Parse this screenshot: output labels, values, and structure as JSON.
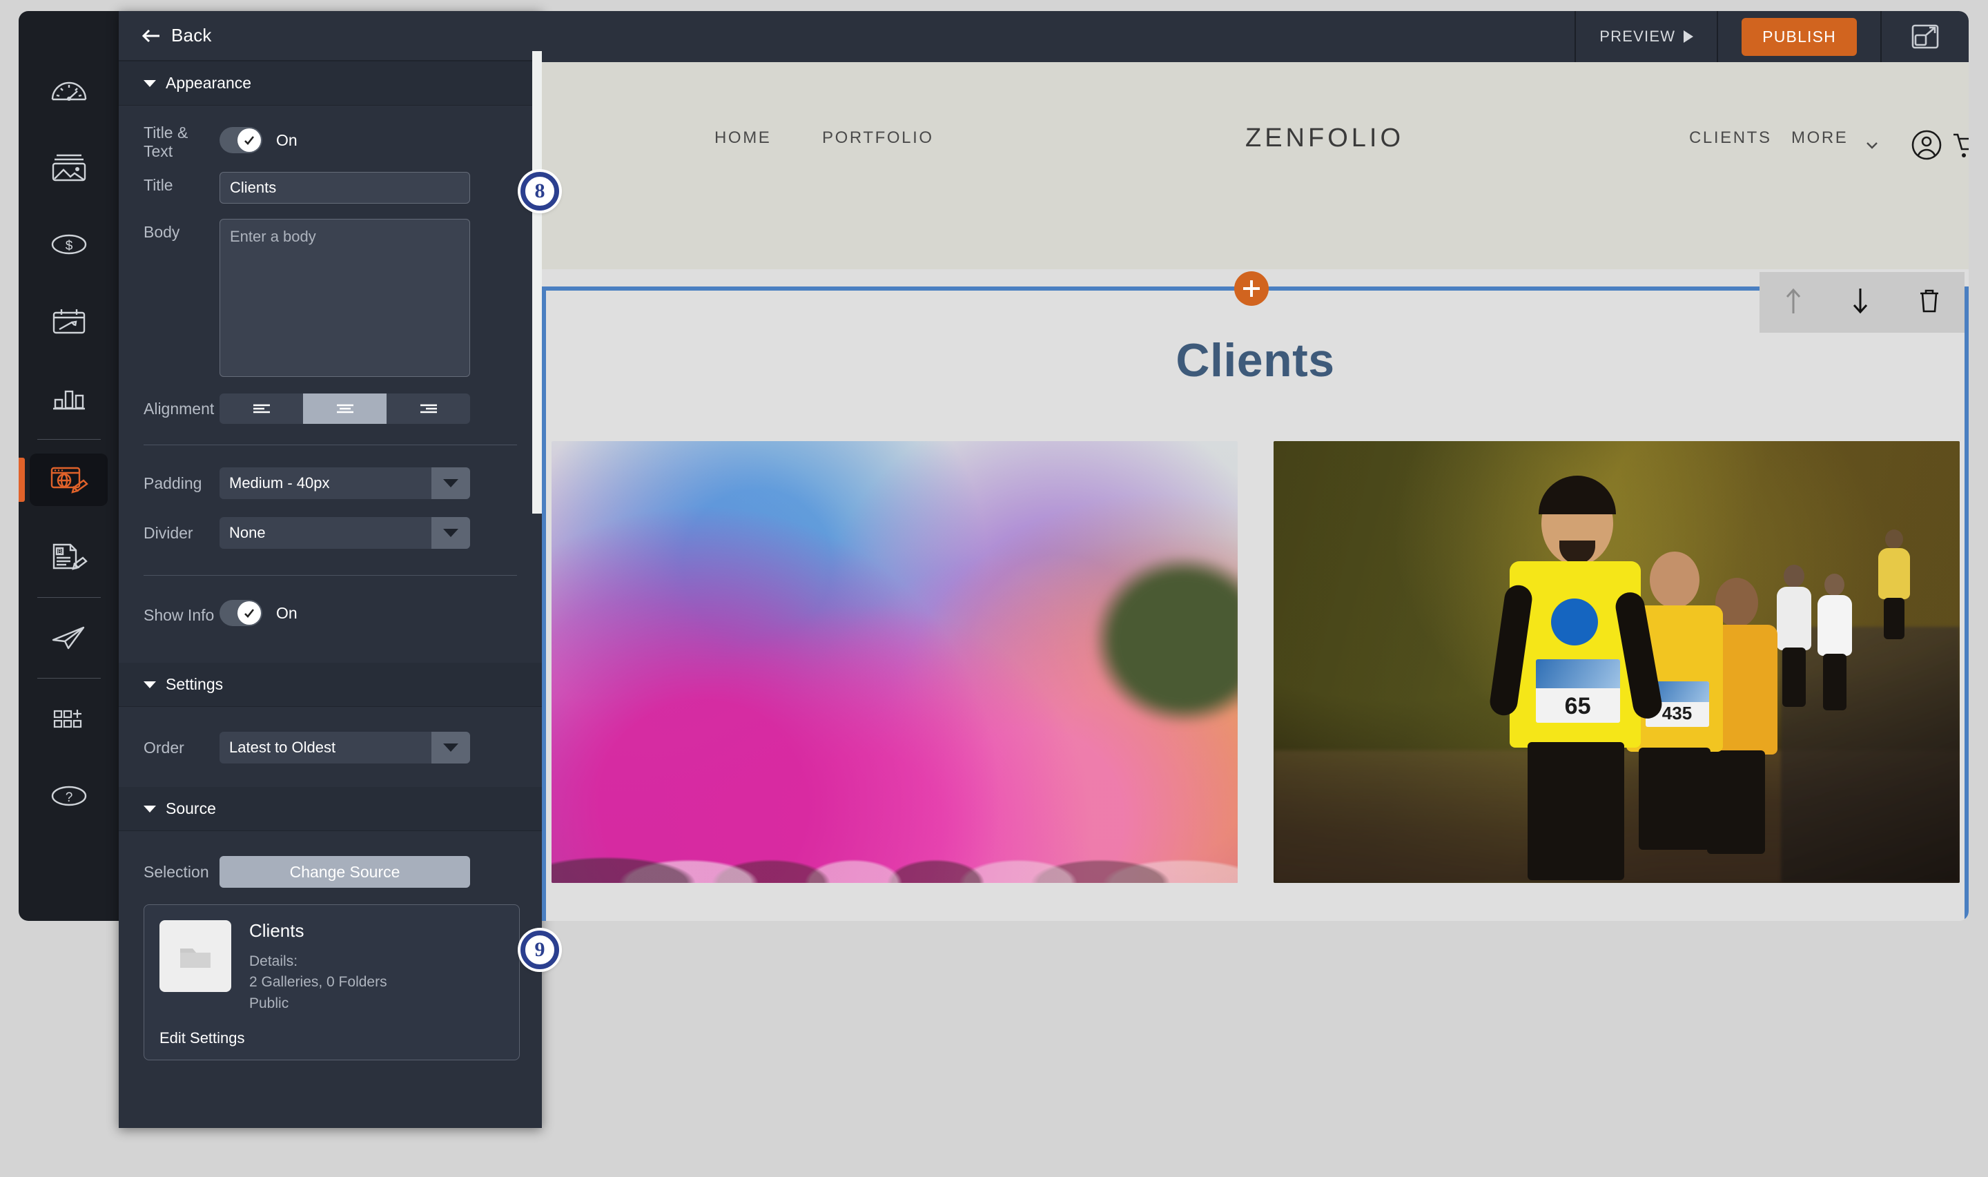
{
  "rail": {
    "items": [
      {
        "name": "dashboard-icon",
        "icon": "gauge"
      },
      {
        "name": "photos-icon",
        "icon": "image"
      },
      {
        "name": "sales-icon",
        "icon": "dollar"
      },
      {
        "name": "bookings-icon",
        "icon": "calendar"
      },
      {
        "name": "stats-icon",
        "icon": "bar-chart"
      },
      {
        "name": "website-editor-icon",
        "icon": "website-pencil"
      },
      {
        "name": "blog-editor-icon",
        "icon": "document-pencil"
      },
      {
        "name": "marketing-icon",
        "icon": "paper-plane"
      },
      {
        "name": "apps-icon",
        "icon": "grid-plus"
      },
      {
        "name": "help-icon",
        "icon": "question"
      }
    ]
  },
  "panel": {
    "back_label": "Back",
    "sections": {
      "appearance": "Appearance",
      "settings": "Settings",
      "source": "Source"
    },
    "title_text_label": "Title & Text",
    "title_text_state": "On",
    "title_label": "Title",
    "title_value": "Clients",
    "body_label": "Body",
    "body_value": "",
    "body_placeholder": "Enter a body",
    "alignment_label": "Alignment",
    "alignment_selected": "center",
    "padding_label": "Padding",
    "padding_value": "Medium - 40px",
    "divider_label": "Divider",
    "divider_value": "None",
    "show_info_label": "Show Info",
    "show_info_state": "On",
    "order_label": "Order",
    "order_value": "Latest to Oldest",
    "selection_label": "Selection",
    "change_source_label": "Change Source",
    "source_card": {
      "title": "Clients",
      "details_label": "Details:",
      "details_counts": "2 Galleries, 0 Folders",
      "visibility": "Public",
      "edit_label": "Edit Settings"
    }
  },
  "topbar": {
    "preview_label": "PREVIEW",
    "publish_label": "PUBLISH",
    "expand_icon": "expand-icon"
  },
  "site": {
    "brand": "ZENFOLIO",
    "nav_left": [
      "HOME",
      "PORTFOLIO"
    ],
    "nav_right": [
      "CLIENTS",
      "MORE"
    ],
    "account_icon": "account-circle-icon",
    "cart_icon": "shopping-cart-icon",
    "page_title": "Clients",
    "block_toolbar": [
      "move-up-icon",
      "move-down-icon",
      "delete-icon"
    ],
    "add_block_icon": "plus-icon",
    "gallery_images": [
      {
        "alt": "color-festival-crowd"
      },
      {
        "alt": "marathon-runners",
        "bibs": [
          "65",
          "435"
        ]
      }
    ]
  },
  "badges": [
    {
      "number": "8"
    },
    {
      "number": "9"
    }
  ],
  "colors": {
    "accent_orange": "#d1641f",
    "panel_bg": "#2b313d",
    "rail_bg": "#1b1e24",
    "badge_navy": "#2b3f8f",
    "selection_blue": "#4a7fc1",
    "title_blue": "#3e5a7a"
  }
}
